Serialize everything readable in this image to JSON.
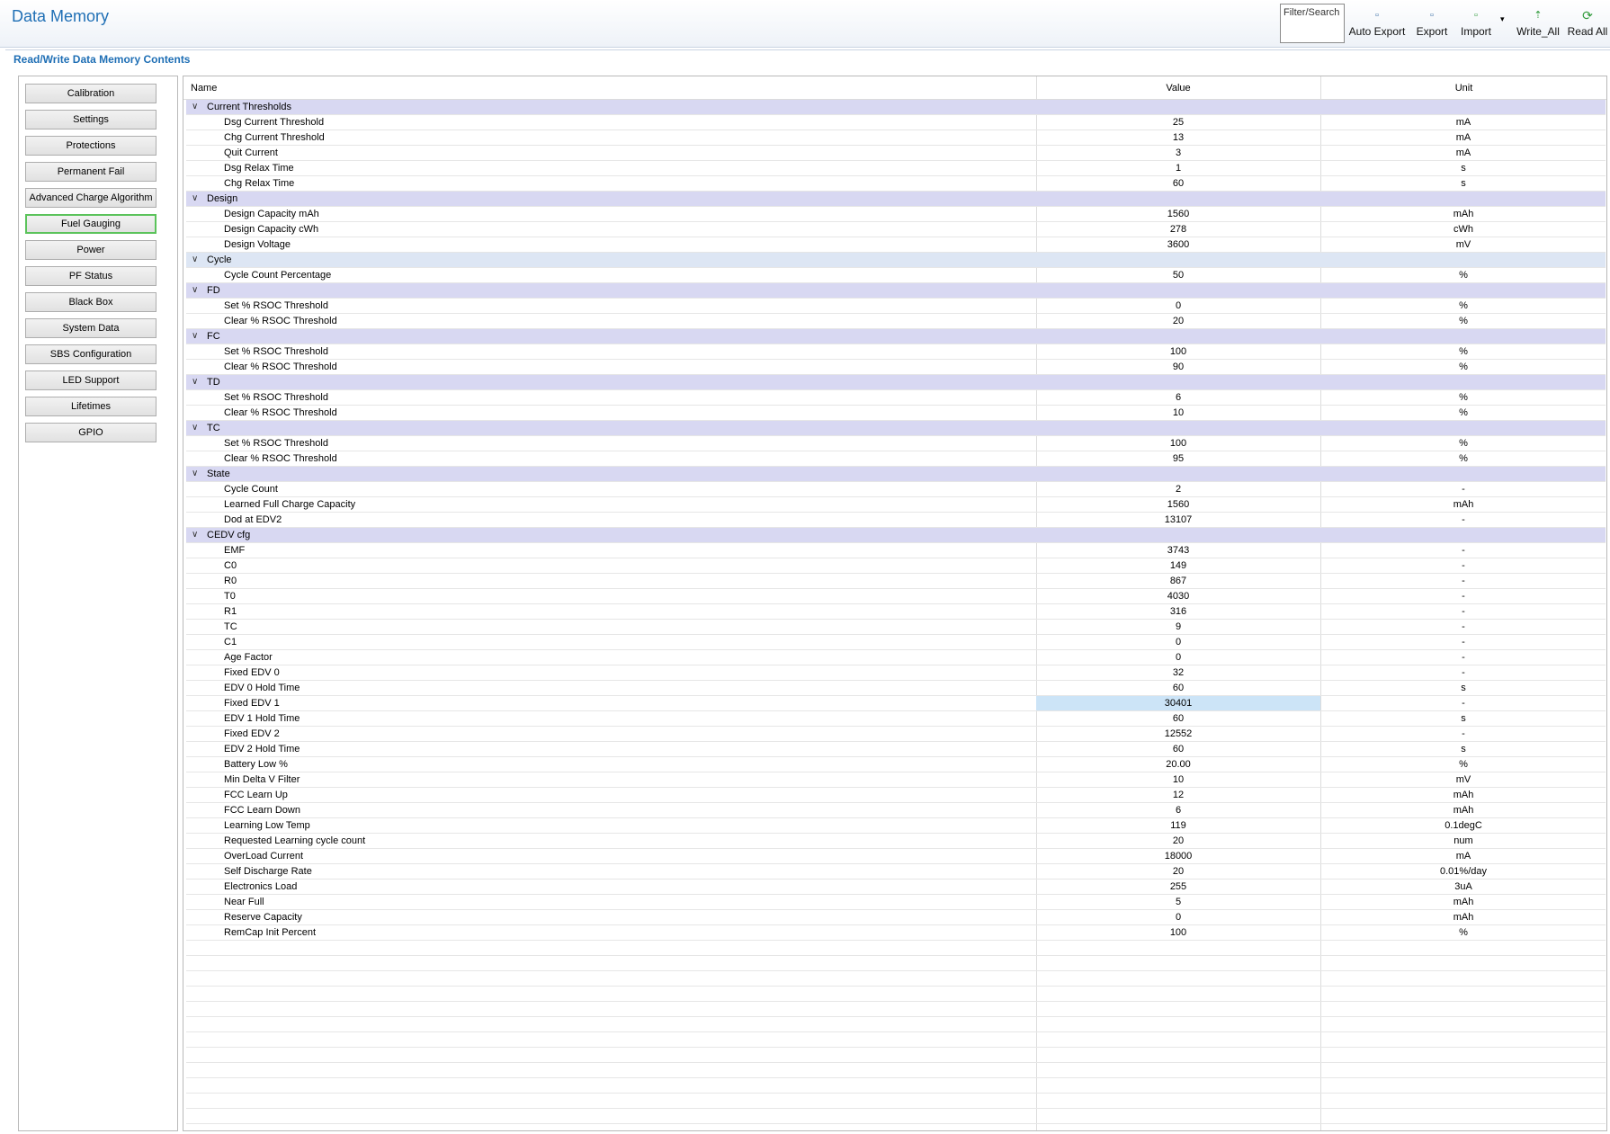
{
  "header": {
    "title": "Data Memory",
    "filter_placeholder": "Filter/Search",
    "toolbar": {
      "auto_export": "Auto Export",
      "export": "Export",
      "import": "Import",
      "import_dropdown": "▾",
      "write_all": "Write_All",
      "read_all": "Read All"
    }
  },
  "section_title": "Read/Write Data Memory Contents",
  "nav": [
    "Calibration",
    "Settings",
    "Protections",
    "Permanent Fail",
    "Advanced Charge Algorithm",
    "Fuel Gauging",
    "Power",
    "PF Status",
    "Black Box",
    "System Data",
    "SBS Configuration",
    "LED Support",
    "Lifetimes",
    "GPIO"
  ],
  "nav_selected": "Fuel Gauging",
  "columns": {
    "name": "Name",
    "value": "Value",
    "unit": "Unit"
  },
  "rows": [
    {
      "type": "group",
      "name": "Current Thresholds"
    },
    {
      "name": "Dsg Current Threshold",
      "value": "25",
      "unit": "mA"
    },
    {
      "name": "Chg Current Threshold",
      "value": "13",
      "unit": "mA"
    },
    {
      "name": "Quit Current",
      "value": "3",
      "unit": "mA"
    },
    {
      "name": "Dsg Relax Time",
      "value": "1",
      "unit": "s"
    },
    {
      "name": "Chg Relax Time",
      "value": "60",
      "unit": "s"
    },
    {
      "type": "group",
      "name": "Design"
    },
    {
      "name": "Design Capacity mAh",
      "value": "1560",
      "unit": "mAh"
    },
    {
      "name": "Design Capacity cWh",
      "value": "278",
      "unit": "cWh"
    },
    {
      "name": "Design Voltage",
      "value": "3600",
      "unit": "mV"
    },
    {
      "type": "group",
      "name": "Cycle",
      "light": true
    },
    {
      "name": "Cycle Count Percentage",
      "value": "50",
      "unit": "%"
    },
    {
      "type": "group",
      "name": "FD"
    },
    {
      "name": "Set % RSOC Threshold",
      "value": "0",
      "unit": "%"
    },
    {
      "name": "Clear % RSOC Threshold",
      "value": "20",
      "unit": "%"
    },
    {
      "type": "group",
      "name": "FC"
    },
    {
      "name": "Set % RSOC Threshold",
      "value": "100",
      "unit": "%"
    },
    {
      "name": "Clear % RSOC Threshold",
      "value": "90",
      "unit": "%"
    },
    {
      "type": "group",
      "name": "TD"
    },
    {
      "name": "Set % RSOC Threshold",
      "value": "6",
      "unit": "%"
    },
    {
      "name": "Clear % RSOC Threshold",
      "value": "10",
      "unit": "%"
    },
    {
      "type": "group",
      "name": "TC"
    },
    {
      "name": "Set % RSOC Threshold",
      "value": "100",
      "unit": "%"
    },
    {
      "name": "Clear % RSOC Threshold",
      "value": "95",
      "unit": "%"
    },
    {
      "type": "group",
      "name": "State"
    },
    {
      "name": "Cycle Count",
      "value": "2",
      "unit": "-"
    },
    {
      "name": "Learned Full Charge Capacity",
      "value": "1560",
      "unit": "mAh"
    },
    {
      "name": "Dod at EDV2",
      "value": "13107",
      "unit": "-"
    },
    {
      "type": "group",
      "name": "CEDV cfg"
    },
    {
      "name": "EMF",
      "value": "3743",
      "unit": "-"
    },
    {
      "name": "C0",
      "value": "149",
      "unit": "-"
    },
    {
      "name": "R0",
      "value": "867",
      "unit": "-"
    },
    {
      "name": "T0",
      "value": "4030",
      "unit": "-"
    },
    {
      "name": "R1",
      "value": "316",
      "unit": "-"
    },
    {
      "name": "TC",
      "value": "9",
      "unit": "-"
    },
    {
      "name": "C1",
      "value": "0",
      "unit": "-"
    },
    {
      "name": "Age Factor",
      "value": "0",
      "unit": "-"
    },
    {
      "name": "Fixed EDV 0",
      "value": "32",
      "unit": "-"
    },
    {
      "name": "EDV 0 Hold Time",
      "value": "60",
      "unit": "s"
    },
    {
      "name": "Fixed EDV 1",
      "value": "30401",
      "unit": "-",
      "highlight": true
    },
    {
      "name": "EDV 1 Hold Time",
      "value": "60",
      "unit": "s"
    },
    {
      "name": "Fixed EDV 2",
      "value": "12552",
      "unit": "-"
    },
    {
      "name": "EDV 2 Hold Time",
      "value": "60",
      "unit": "s"
    },
    {
      "name": "Battery Low %",
      "value": "20.00",
      "unit": "%"
    },
    {
      "name": "Min Delta V Filter",
      "value": "10",
      "unit": "mV"
    },
    {
      "name": "FCC Learn Up",
      "value": "12",
      "unit": "mAh"
    },
    {
      "name": "FCC Learn Down",
      "value": "6",
      "unit": "mAh"
    },
    {
      "name": "Learning Low Temp",
      "value": "119",
      "unit": "0.1degC"
    },
    {
      "name": "Requested Learning cycle count",
      "value": "20",
      "unit": "num"
    },
    {
      "name": "OverLoad Current",
      "value": "18000",
      "unit": "mA"
    },
    {
      "name": "Self Discharge Rate",
      "value": "20",
      "unit": "0.01%/day"
    },
    {
      "name": "Electronics Load",
      "value": "255",
      "unit": "3uA"
    },
    {
      "name": "Near Full",
      "value": "5",
      "unit": "mAh"
    },
    {
      "name": "Reserve Capacity",
      "value": "0",
      "unit": "mAh"
    },
    {
      "name": "RemCap Init Percent",
      "value": "100",
      "unit": "%"
    }
  ],
  "colors": {
    "title": "#1f6fb5",
    "group_row": "#d8d8f2",
    "selected_cell": "#cce4f7",
    "selected_nav_border": "#5bc35b"
  }
}
